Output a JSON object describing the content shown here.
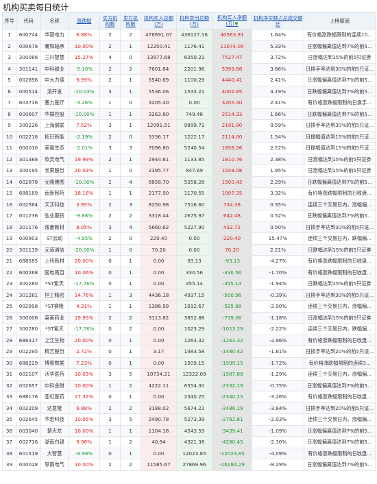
{
  "title": "机构买卖每日统计",
  "headers": {
    "seq": "序号",
    "code": "代码",
    "name": "名称",
    "change": "涨跌幅",
    "buy_count": "买方机构数",
    "sell_count": "卖方机构数",
    "buy_amount": "机构买入总额(万)",
    "sell_amount": "机构卖出总额(万)",
    "net_amount": "机构买入净额(万)",
    "ratio": "机构净买额占总成交额比",
    "reason": "上榜原因"
  },
  "colors": {
    "up": "#e0201b",
    "down": "#1a9a2a",
    "link": "#1a54b5"
  },
  "rows": [
    {
      "seq": "1",
      "code": "600744",
      "name": "华银电力",
      "change": "6.88%",
      "buy_count": "2",
      "sell_count": "2",
      "buy_amount": "476691.07",
      "sell_amount": "436127.16",
      "net_amount": "40563.91",
      "ratio": "1.64%",
      "reason": "有价格涨跌幅限制的连续10..."
    },
    {
      "seq": "2",
      "code": "000678",
      "name": "襄阳轴承",
      "change": "10.00%",
      "buy_count": "2",
      "sell_count": "1",
      "buy_amount": "12250.41",
      "sell_amount": "1176.41",
      "net_amount": "11074.00",
      "ratio": "5.33%",
      "reason": "日涨幅偏离值达到7%的前5..."
    },
    {
      "seq": "3",
      "code": "300066",
      "name": "三川智慧",
      "change": "15.27%",
      "buy_count": "4",
      "sell_count": "0",
      "buy_amount": "13877.68",
      "sell_amount": "6350.21",
      "net_amount": "7527.47",
      "ratio": "3.72%",
      "reason": "日涨幅达到15%的前5只证券"
    },
    {
      "seq": "4",
      "code": "301141",
      "name": "中科磁业",
      "change": "-5.10%",
      "buy_count": "2",
      "sell_count": "2",
      "buy_amount": "7601.84",
      "sell_amount": "2201.96",
      "net_amount": "5399.88",
      "ratio": "3.66%",
      "reason": "日换手率达到30%的前5只证..."
    },
    {
      "seq": "5",
      "code": "002896",
      "name": "中大力德",
      "change": "9.99%",
      "buy_count": "2",
      "sell_count": "1",
      "buy_amount": "5540.69",
      "sell_amount": "1100.29",
      "net_amount": "4440.41",
      "ratio": "2.41%",
      "reason": "日涨幅偏离值达到7%的前5..."
    },
    {
      "seq": "6",
      "code": "000514",
      "name": "渝开发",
      "change": "-10.03%",
      "buy_count": "3",
      "sell_count": "1",
      "buy_amount": "5536.06",
      "sell_amount": "1533.21",
      "net_amount": "4002.85",
      "ratio": "4.19%",
      "reason": "日跌幅偏离值达到7%的前5..."
    },
    {
      "seq": "7",
      "code": "603716",
      "name": "塞力医疗",
      "change": "-3.26%",
      "buy_count": "1",
      "sell_count": "0",
      "buy_amount": "3205.40",
      "sell_amount": "0.00",
      "net_amount": "3205.40",
      "ratio": "2.41%",
      "reason": "有价格涨跌幅限制的日换手..."
    },
    {
      "seq": "8",
      "code": "000607",
      "name": "华媒控股",
      "change": "-10.00%",
      "buy_count": "1",
      "sell_count": "1",
      "buy_amount": "3263.80",
      "sell_amount": "749.48",
      "net_amount": "2514.33",
      "ratio": "1.66%",
      "reason": "日跌幅偏离值达到7%的前5..."
    },
    {
      "seq": "9",
      "code": "300226",
      "name": "上海钢联",
      "change": "7.52%",
      "buy_count": "3",
      "sell_count": "1",
      "buy_amount": "12091.51",
      "sell_amount": "9899.71",
      "net_amount": "2191.80",
      "ratio": "0.59%",
      "reason": "日换手率达到30%的前5只证..."
    },
    {
      "seq": "10",
      "code": "002218",
      "name": "拓日新能",
      "change": "-2.19%",
      "buy_count": "2",
      "sell_count": "0",
      "buy_amount": "3336.17",
      "sell_amount": "1222.17",
      "net_amount": "2114.00",
      "ratio": "1.54%",
      "reason": "日振幅值达到15%的前5只证..."
    },
    {
      "seq": "11",
      "code": "000010",
      "name": "美丽生态",
      "change": "-2.01%",
      "buy_count": "3",
      "sell_count": "3",
      "buy_amount": "7096.80",
      "sell_amount": "5240.54",
      "net_amount": "1856.26",
      "ratio": "2.22%",
      "reason": "日振幅值达到15%的前5只证..."
    },
    {
      "seq": "12",
      "code": "301388",
      "name": "欣灵电气",
      "change": "19.99%",
      "buy_count": "2",
      "sell_count": "1",
      "buy_amount": "2944.61",
      "sell_amount": "1133.85",
      "net_amount": "1810.76",
      "ratio": "2.38%",
      "reason": "日涨幅达到15%的前5只证券"
    },
    {
      "seq": "13",
      "code": "300195",
      "name": "长荣股份",
      "change": "20.03%",
      "buy_count": "1",
      "sell_count": "0",
      "buy_amount": "2395.77",
      "sell_amount": "847.69",
      "net_amount": "1548.08",
      "ratio": "1.95%",
      "reason": "日涨幅达到15%的前5只证券"
    },
    {
      "seq": "14",
      "code": "002878",
      "name": "元隆雅图",
      "change": "-10.00%",
      "buy_count": "2",
      "sell_count": "4",
      "buy_amount": "6858.70",
      "sell_amount": "5358.28",
      "net_amount": "1500.43",
      "ratio": "2.29%",
      "reason": "日跌幅偏离值达到7%的前5..."
    },
    {
      "seq": "15",
      "code": "688189",
      "name": "南新制药",
      "change": "18.16%",
      "buy_count": "1",
      "sell_count": "1",
      "buy_amount": "2177.90",
      "sell_amount": "1170.55",
      "net_amount": "1007.35",
      "ratio": "3.32%",
      "reason": "有价格涨跌幅限制的日收盘..."
    },
    {
      "seq": "16",
      "code": "002564",
      "name": "天沃科技",
      "change": "3.95%",
      "buy_count": "2",
      "sell_count": "3",
      "buy_amount": "8250.98",
      "sell_amount": "7516.60",
      "net_amount": "734.38",
      "ratio": "0.35%",
      "reason": "连续三个交易日内，涨幅偏..."
    },
    {
      "seq": "17",
      "code": "001236",
      "name": "弘业期货",
      "change": "-9.88%",
      "buy_count": "2",
      "sell_count": "2",
      "buy_amount": "3318.44",
      "sell_amount": "2675.97",
      "net_amount": "642.48",
      "ratio": "0.52%",
      "reason": "日跌幅偏离值达到7%的前5..."
    },
    {
      "seq": "18",
      "code": "301176",
      "name": "逸豪新材",
      "change": "8.05%",
      "buy_count": "3",
      "sell_count": "4",
      "buy_amount": "5660.62",
      "sell_amount": "5227.90",
      "net_amount": "432.72",
      "ratio": "0.50%",
      "reason": "日换手率达到30%的前5只证..."
    },
    {
      "seq": "19",
      "code": "000903",
      "name": "ST云动",
      "change": "-4.95%",
      "buy_count": "2",
      "sell_count": "0",
      "buy_amount": "220.40",
      "sell_amount": "0.00",
      "net_amount": "220.40",
      "ratio": "15.47%",
      "reason": "连续三个交易日内，跌幅偏..."
    },
    {
      "seq": "20",
      "code": "301139",
      "name": "元道通信",
      "change": "-20.00%",
      "buy_count": "1",
      "sell_count": "0",
      "buy_amount": "70.20",
      "sell_amount": "0.00",
      "net_amount": "70.20",
      "ratio": "2.21%",
      "reason": "日跌幅达到15%的前5只证券"
    },
    {
      "seq": "21",
      "code": "688585",
      "name": "上纬新材",
      "change": "20.00%",
      "buy_count": "0",
      "sell_count": "1",
      "buy_amount": "0.00",
      "sell_amount": "93.13",
      "net_amount": "-93.13",
      "ratio": "-4.27%",
      "reason": "有价格涨跌幅限制的日收盘..."
    },
    {
      "seq": "22",
      "code": "600268",
      "name": "国电南自",
      "change": "10.06%",
      "buy_count": "0",
      "sell_count": "1",
      "buy_amount": "0.00",
      "sell_amount": "330.56",
      "net_amount": "-330.56",
      "ratio": "-1.70%",
      "reason": "有价格涨跌幅限制的日收盘..."
    },
    {
      "seq": "23",
      "code": "300280",
      "name": "*ST紫天",
      "change": "-17.76%",
      "buy_count": "0",
      "sell_count": "1",
      "buy_amount": "0.00",
      "sell_amount": "355.14",
      "net_amount": "-355.14",
      "ratio": "-1.94%",
      "reason": "日跌幅达到15%的前5只证券"
    },
    {
      "seq": "24",
      "code": "301261",
      "name": "恒工精密",
      "change": "14.76%",
      "buy_count": "1",
      "sell_count": "3",
      "buy_amount": "4436.18",
      "sell_amount": "4937.15",
      "net_amount": "-500.96",
      "ratio": "-0.39%",
      "reason": "日换手率达到30%的前5只证..."
    },
    {
      "seq": "25",
      "code": "002898",
      "name": "*ST赛隆",
      "change": "4.31%",
      "buy_count": "1",
      "sell_count": "1",
      "buy_amount": "1386.99",
      "sell_amount": "1912.67",
      "net_amount": "-525.68",
      "ratio": "-2.90%",
      "reason": "连续三个交易日内，涨幅偏..."
    },
    {
      "seq": "26",
      "code": "300006",
      "name": "莱美药业",
      "change": "19.95%",
      "buy_count": "2",
      "sell_count": "2",
      "buy_amount": "3113.82",
      "sell_amount": "3852.88",
      "net_amount": "-739.06",
      "ratio": "-1.18%",
      "reason": "日涨幅达到15%的前5只证券"
    },
    {
      "seq": "27",
      "code": "300280",
      "name": "*ST紫天",
      "change": "-17.76%",
      "buy_count": "0",
      "sell_count": "2",
      "buy_amount": "0.00",
      "sell_amount": "1023.29",
      "net_amount": "-1023.29",
      "ratio": "-2.22%",
      "reason": "连续三个交易日内，跌幅偏..."
    },
    {
      "seq": "28",
      "code": "688317",
      "name": "之江生物",
      "change": "20.00%",
      "buy_count": "0",
      "sell_count": "1",
      "buy_amount": "0.00",
      "sell_amount": "1263.32",
      "net_amount": "-1263.32",
      "ratio": "-2.96%",
      "reason": "有价格涨跌幅限制的日收盘..."
    },
    {
      "seq": "29",
      "code": "002295",
      "name": "精艺股份",
      "change": "2.72%",
      "buy_count": "0",
      "sell_count": "1",
      "buy_amount": "3.17",
      "sell_amount": "1483.58",
      "net_amount": "-1480.42",
      "ratio": "-1.61%",
      "reason": "日换手率达到20%的前5只证..."
    },
    {
      "seq": "30",
      "code": "688229",
      "name": "博睿数据",
      "change": "7.23%",
      "buy_count": "0",
      "sell_count": "1",
      "buy_amount": "0.00",
      "sell_amount": "1509.15",
      "net_amount": "-1509.15",
      "ratio": "-1.72%",
      "reason": "有价格涨跌幅限制的连续3..."
    },
    {
      "seq": "31",
      "code": "002107",
      "name": "沃华医药",
      "change": "10.03%",
      "buy_count": "3",
      "sell_count": "5",
      "buy_amount": "10734.21",
      "sell_amount": "12322.09",
      "net_amount": "-1587.88",
      "ratio": "-1.29%",
      "reason": "连续三个交易日内，涨幅偏..."
    },
    {
      "seq": "32",
      "code": "002657",
      "name": "中科金财",
      "change": "10.00%",
      "buy_count": "1",
      "sell_count": "2",
      "buy_amount": "4222.11",
      "sell_amount": "6554.30",
      "net_amount": "-2332.19",
      "ratio": "-0.75%",
      "reason": "日涨幅偏离值达到7%的前5..."
    },
    {
      "seq": "33",
      "code": "688176",
      "name": "亚虹医药",
      "change": "17.32%",
      "buy_count": "0",
      "sell_count": "1",
      "buy_amount": "0.00",
      "sell_amount": "2340.25",
      "net_amount": "-2340.25",
      "ratio": "-3.26%",
      "reason": "有价格涨跌幅限制的日收盘..."
    },
    {
      "seq": "34",
      "code": "002209",
      "name": "达意隆",
      "change": "9.98%",
      "buy_count": "2",
      "sell_count": "2",
      "buy_amount": "3188.02",
      "sell_amount": "5674.22",
      "net_amount": "-2486.19",
      "ratio": "-3.84%",
      "reason": "日换手率达到20%的前5只证..."
    },
    {
      "seq": "35",
      "code": "002645",
      "name": "华宏科技",
      "change": "10.05%",
      "buy_count": "3",
      "sell_count": "5",
      "buy_amount": "2490.78",
      "sell_amount": "5273.39",
      "net_amount": "-2782.61",
      "ratio": "-2.03%",
      "reason": "连续三个交易日内，涨幅偏..."
    },
    {
      "seq": "36",
      "code": "003040",
      "name": "楚天龙",
      "change": "10.00%",
      "buy_count": "1",
      "sell_count": "1",
      "buy_amount": "1104.18",
      "sell_amount": "4543.59",
      "net_amount": "-3439.41",
      "ratio": "-1.09%",
      "reason": "日涨幅偏离值达到7%的前5..."
    },
    {
      "seq": "37",
      "code": "002716",
      "name": "湖南白银",
      "change": "9.98%",
      "buy_count": "1",
      "sell_count": "2",
      "buy_amount": "40.94",
      "sell_amount": "4321.38",
      "net_amount": "-4280.45",
      "ratio": "-2.30%",
      "reason": "日涨幅偏离值达到7%的前5..."
    },
    {
      "seq": "38",
      "code": "601519",
      "name": "大智慧",
      "change": "-9.99%",
      "buy_count": "0",
      "sell_count": "1",
      "buy_amount": "0.00",
      "sell_amount": "12023.85",
      "net_amount": "-12023.85",
      "ratio": "-4.09%",
      "reason": "有价格涨跌幅限制的日收盘..."
    },
    {
      "seq": "39",
      "code": "000028",
      "name": "思雨电气",
      "change": "10.00%",
      "buy_count": "2",
      "sell_count": "2",
      "buy_amount": "11585.67",
      "sell_amount": "27869.96",
      "net_amount": "-16284.29",
      "ratio": "-8.29%",
      "reason": "日涨幅偏离值达到7%的前5..."
    }
  ]
}
